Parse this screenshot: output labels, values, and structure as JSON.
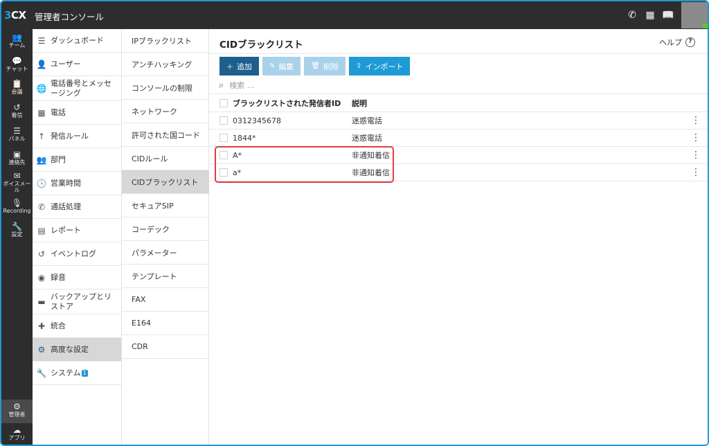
{
  "app": {
    "logo_prefix": "3",
    "logo_suffix": "CX",
    "title": "管理者コンソール"
  },
  "topbar": {
    "icons": [
      "phone-icon",
      "qr-code-icon",
      "book-icon"
    ]
  },
  "rail": {
    "items": [
      {
        "label": "チーム",
        "icon": "team-icon",
        "glyph": "👥"
      },
      {
        "label": "チャット",
        "icon": "chat-icon",
        "glyph": "💬"
      },
      {
        "label": "会議",
        "icon": "meeting-icon",
        "glyph": "📋"
      },
      {
        "label": "着信",
        "icon": "history-icon",
        "glyph": "↺"
      },
      {
        "label": "パネル",
        "icon": "panel-icon",
        "glyph": "☰"
      },
      {
        "label": "連絡先",
        "icon": "contacts-icon",
        "glyph": "▣"
      },
      {
        "label": "ボイスメール",
        "icon": "voicemail-icon",
        "glyph": "✉"
      },
      {
        "label": "Recording",
        "icon": "microphone-icon",
        "glyph": "🎙"
      },
      {
        "label": "設定",
        "icon": "wrench-icon",
        "glyph": "🔧"
      }
    ],
    "admin": {
      "label": "管理者",
      "glyph": "⚙"
    },
    "apps": {
      "label": "アプリ",
      "glyph": "☁"
    }
  },
  "nav1": {
    "items": [
      {
        "label": "ダッシュボード",
        "icon": "dashboard-icon",
        "glyph": "☰"
      },
      {
        "label": "ユーザー",
        "icon": "user-icon",
        "glyph": "👤"
      },
      {
        "label": "電話番号とメッセージング",
        "icon": "globe-icon",
        "glyph": "🌐"
      },
      {
        "label": "電話",
        "icon": "phone-grid-icon",
        "glyph": "▦"
      },
      {
        "label": "発信ルール",
        "icon": "arrow-up-icon",
        "glyph": "↑"
      },
      {
        "label": "部門",
        "icon": "department-icon",
        "glyph": "👥"
      },
      {
        "label": "営業時間",
        "icon": "clock-icon",
        "glyph": "🕓"
      },
      {
        "label": "通話処理",
        "icon": "call-handling-icon",
        "glyph": "✆"
      },
      {
        "label": "レポート",
        "icon": "report-icon",
        "glyph": "▤"
      },
      {
        "label": "イベントログ",
        "icon": "history-icon",
        "glyph": "↺"
      },
      {
        "label": "録音",
        "icon": "record-icon",
        "glyph": "◉"
      },
      {
        "label": "バックアップとリストア",
        "icon": "backup-icon",
        "glyph": "▬"
      },
      {
        "label": "統合",
        "icon": "puzzle-icon",
        "glyph": "✚"
      },
      {
        "label": "高度な設定",
        "icon": "gear-icon",
        "glyph": "⚙"
      },
      {
        "label": "システム",
        "icon": "wrench-icon",
        "glyph": "🔧",
        "badge": "1"
      }
    ]
  },
  "nav2": {
    "items": [
      "IPブラックリスト",
      "アンチハッキング",
      "コンソールの制限",
      "ネットワーク",
      "許可された国コード",
      "CIDルール",
      "CIDブラックリスト",
      "セキュアSIP",
      "コーデック",
      "パラメーター",
      "テンプレート",
      "FAX",
      "E164",
      "CDR"
    ]
  },
  "main": {
    "title": "CIDブラックリスト",
    "help_label": "ヘルプ",
    "toolbar": {
      "add": "追加",
      "edit": "編集",
      "delete": "削除",
      "import": "インポート"
    },
    "search_placeholder": "検索 ...",
    "table": {
      "columns": [
        "ブラックリストされた発信者ID",
        "説明"
      ],
      "rows": [
        {
          "id": "0312345678",
          "desc": "迷惑電話"
        },
        {
          "id": "1844*",
          "desc": "迷惑電話"
        },
        {
          "id": "A*",
          "desc": "非通知着信"
        },
        {
          "id": "a*",
          "desc": "非通知着信"
        }
      ]
    }
  },
  "colors": {
    "accent": "#1e9ad6",
    "dark_bar": "#2d2d2d",
    "primary_button": "#1d5f8c",
    "disabled_button": "#a9d2ea",
    "highlight": "#e23b3b",
    "active_nav": "#d7d7d7"
  }
}
